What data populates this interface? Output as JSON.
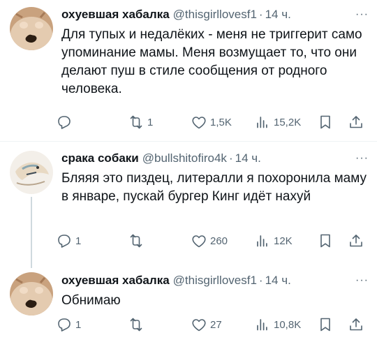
{
  "tweets": [
    {
      "author": "охуевшая хабалка",
      "handle": "@thisgirllovesf1",
      "dot": "·",
      "time": "14 ч.",
      "more": "···",
      "text": "Для тупых и недалёких - меня не триггерит само упоминание мамы. Меня возмущает то, что они делают пуш в стиле сообщения от родного человека.",
      "replies": "",
      "retweets": "1",
      "likes": "1,5K",
      "views": "15,2K"
    },
    {
      "author": "срака собаки",
      "handle": "@bullshitofiro4k",
      "dot": "·",
      "time": "14 ч.",
      "more": "···",
      "text": "Бляяя это пиздец, литералли я похоронила маму в январе, пускай бургер Кинг идёт нахуй",
      "replies": "1",
      "retweets": "",
      "likes": "260",
      "views": "12K"
    },
    {
      "author": "охуевшая хабалка",
      "handle": "@thisgirllovesf1",
      "dot": "·",
      "time": "14 ч.",
      "more": "···",
      "text": "Обнимаю",
      "replies": "1",
      "retweets": "",
      "likes": "27",
      "views": "10,8K"
    }
  ],
  "colors": {
    "text": "#0f1419",
    "secondary": "#536471",
    "separator": "#eff3f4",
    "thread_line": "#cfd9de"
  },
  "icons": [
    "reply-icon",
    "retweet-icon",
    "like-icon",
    "views-icon",
    "bookmark-icon",
    "share-icon"
  ]
}
